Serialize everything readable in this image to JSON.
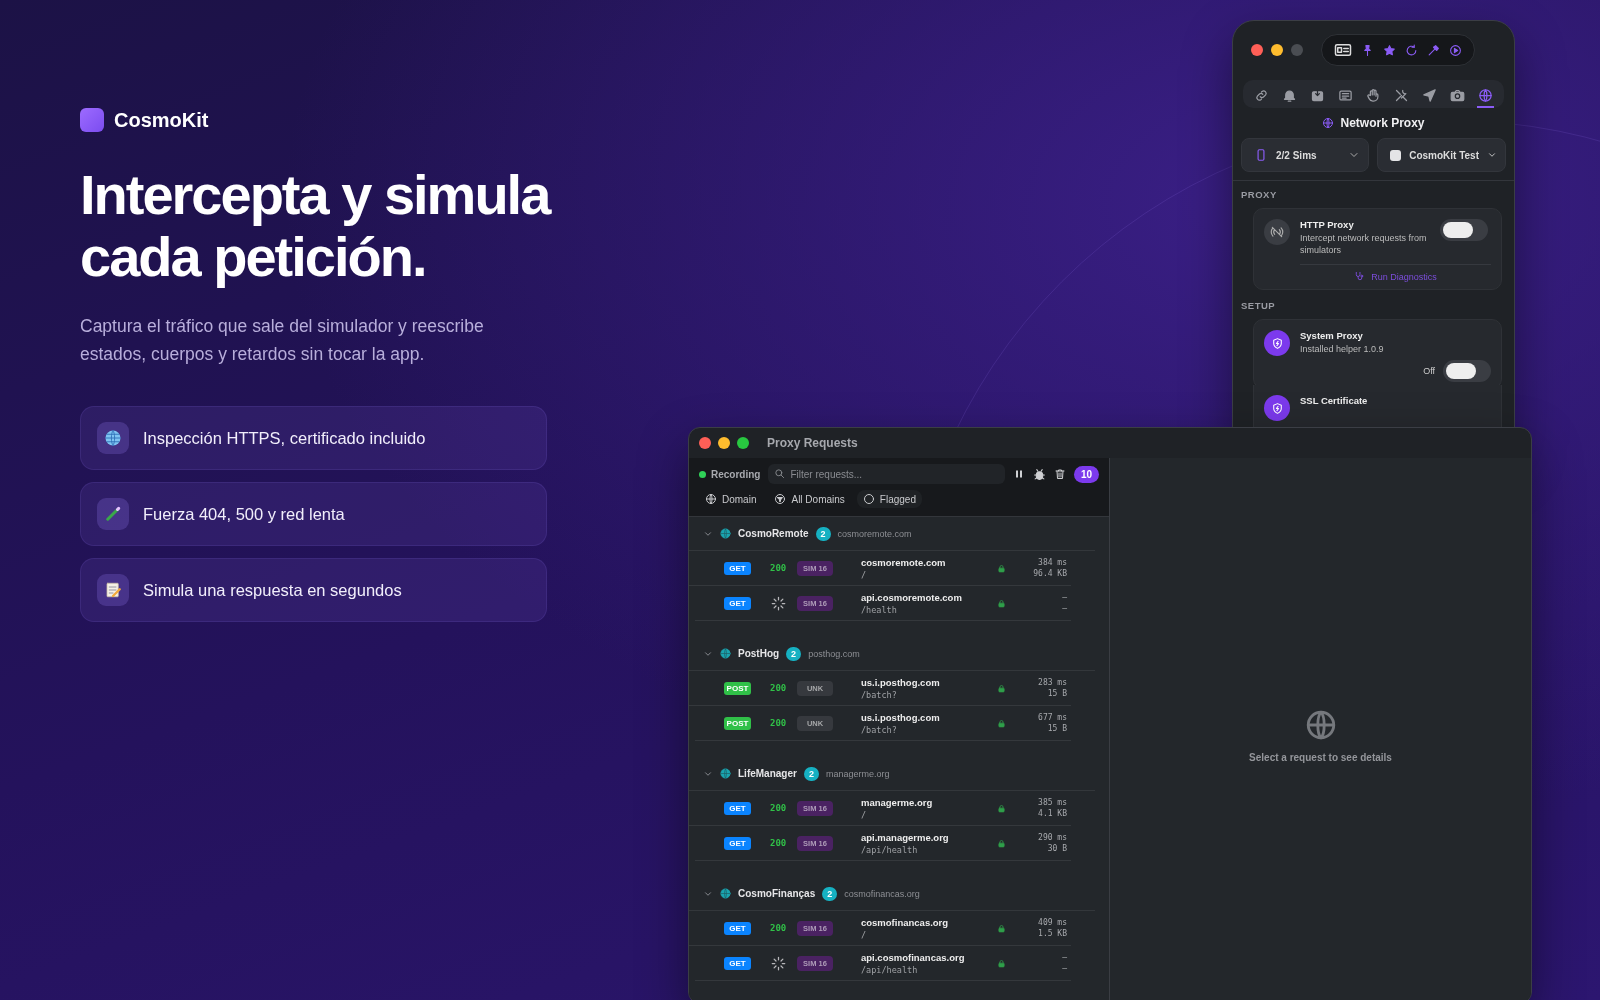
{
  "hero": {
    "brand": "CosmoKit",
    "headline": [
      "Intercepta y simula",
      "cada petición."
    ],
    "description": "Captura el tráfico que sale del simulador y reescribe estados, cuerpos y retardos sin tocar la app.",
    "features": [
      "Inspección HTTPS, certificado incluido",
      "Fuerza 404, 500 y red lenta",
      "Simula una respuesta en segundos"
    ]
  },
  "inspector": {
    "tabs": [
      {
        "selected": false
      },
      {
        "selected": false
      },
      {
        "selected": false
      },
      {
        "selected": false
      },
      {
        "selected": false
      },
      {
        "selected": false
      },
      {
        "selected": false
      },
      {
        "selected": false
      },
      {
        "selected": true
      }
    ],
    "title": "Network Proxy",
    "sims": "2/2 Sims",
    "device": "CosmoKit Test",
    "sections": [
      {
        "heading": "PROXY",
        "items": [
          {
            "kind": "toggle",
            "title": "HTTP Proxy",
            "subtitle": "Intercept network requests from simulators",
            "on": false,
            "link": "Run Diagnostics"
          }
        ]
      },
      {
        "heading": "SETUP",
        "items": [
          {
            "kind": "setup",
            "title": "System Proxy",
            "subtitle": "Installed helper 1.0.9",
            "toggle_label": "Off",
            "on": false
          },
          {
            "kind": "setup",
            "title": "SSL Certificate"
          }
        ]
      }
    ]
  },
  "proxy": {
    "title": "Proxy Requests",
    "recording": {
      "label": "Recording",
      "on": true
    },
    "filter_placeholder": "Filter requests...",
    "count": "10",
    "filters": [
      {
        "kind": "menu",
        "label": "Domain"
      },
      {
        "kind": "menu",
        "label": "All Domains"
      },
      {
        "kind": "toggle",
        "label": "Flagged",
        "checked": false
      }
    ],
    "groups": [
      {
        "name": "CosmoRemote",
        "count": "2",
        "domain": "cosmoremote.com",
        "expanded": true,
        "requests": [
          {
            "kind": "complete",
            "method": {
              "label": "GET",
              "color": "#0a84ff"
            },
            "status": "200",
            "tag": {
              "label": "SIM 16",
              "color": "#4a2262"
            },
            "host": "cosmoremote.com",
            "path": "/",
            "secure": true,
            "time": "384 ms",
            "size": "96.4 KB"
          },
          {
            "kind": "pending",
            "method": {
              "label": "GET",
              "color": "#0a84ff"
            },
            "tag": {
              "label": "SIM 16",
              "color": "#4a2262"
            },
            "host": "api.cosmoremote.com",
            "path": "/health",
            "secure": true,
            "time": "–",
            "size": "–"
          }
        ]
      },
      {
        "name": "PostHog",
        "count": "2",
        "domain": "posthog.com",
        "expanded": true,
        "requests": [
          {
            "kind": "complete",
            "method": {
              "label": "POST",
              "color": "#30c048"
            },
            "status": "200",
            "tag": {
              "label": "UNK",
              "color": "#36393e"
            },
            "host": "us.i.posthog.com",
            "path": "/batch?",
            "secure": true,
            "time": "283 ms",
            "size": "15 B"
          },
          {
            "kind": "complete",
            "method": {
              "label": "POST",
              "color": "#30c048"
            },
            "status": "200",
            "tag": {
              "label": "UNK",
              "color": "#36393e"
            },
            "host": "us.i.posthog.com",
            "path": "/batch?",
            "secure": true,
            "time": "677 ms",
            "size": "15 B"
          }
        ]
      },
      {
        "name": "LifeManager",
        "count": "2",
        "domain": "managerme.org",
        "expanded": true,
        "requests": [
          {
            "kind": "complete",
            "method": {
              "label": "GET",
              "color": "#0a84ff"
            },
            "status": "200",
            "tag": {
              "label": "SIM 16",
              "color": "#4a2262"
            },
            "host": "managerme.org",
            "path": "/",
            "secure": true,
            "time": "385 ms",
            "size": "4.1 KB"
          },
          {
            "kind": "complete",
            "method": {
              "label": "GET",
              "color": "#0a84ff"
            },
            "status": "200",
            "tag": {
              "label": "SIM 16",
              "color": "#4a2262"
            },
            "host": "api.managerme.org",
            "path": "/api/health",
            "secure": true,
            "time": "290 ms",
            "size": "30 B"
          }
        ]
      },
      {
        "name": "CosmoFinanças",
        "count": "2",
        "domain": "cosmofinancas.org",
        "expanded": true,
        "requests": [
          {
            "kind": "complete",
            "method": {
              "label": "GET",
              "color": "#0a84ff"
            },
            "status": "200",
            "tag": {
              "label": "SIM 16",
              "color": "#4a2262"
            },
            "host": "cosmofinancas.org",
            "path": "/",
            "secure": true,
            "time": "409 ms",
            "size": "1.5 KB"
          },
          {
            "kind": "pending",
            "method": {
              "label": "GET",
              "color": "#0a84ff"
            },
            "tag": {
              "label": "SIM 16",
              "color": "#4a2262"
            },
            "host": "api.cosmofinancas.org",
            "path": "/api/health",
            "secure": true,
            "time": "–",
            "size": "–"
          }
        ]
      }
    ],
    "empty_detail": "Select a request to see details"
  }
}
